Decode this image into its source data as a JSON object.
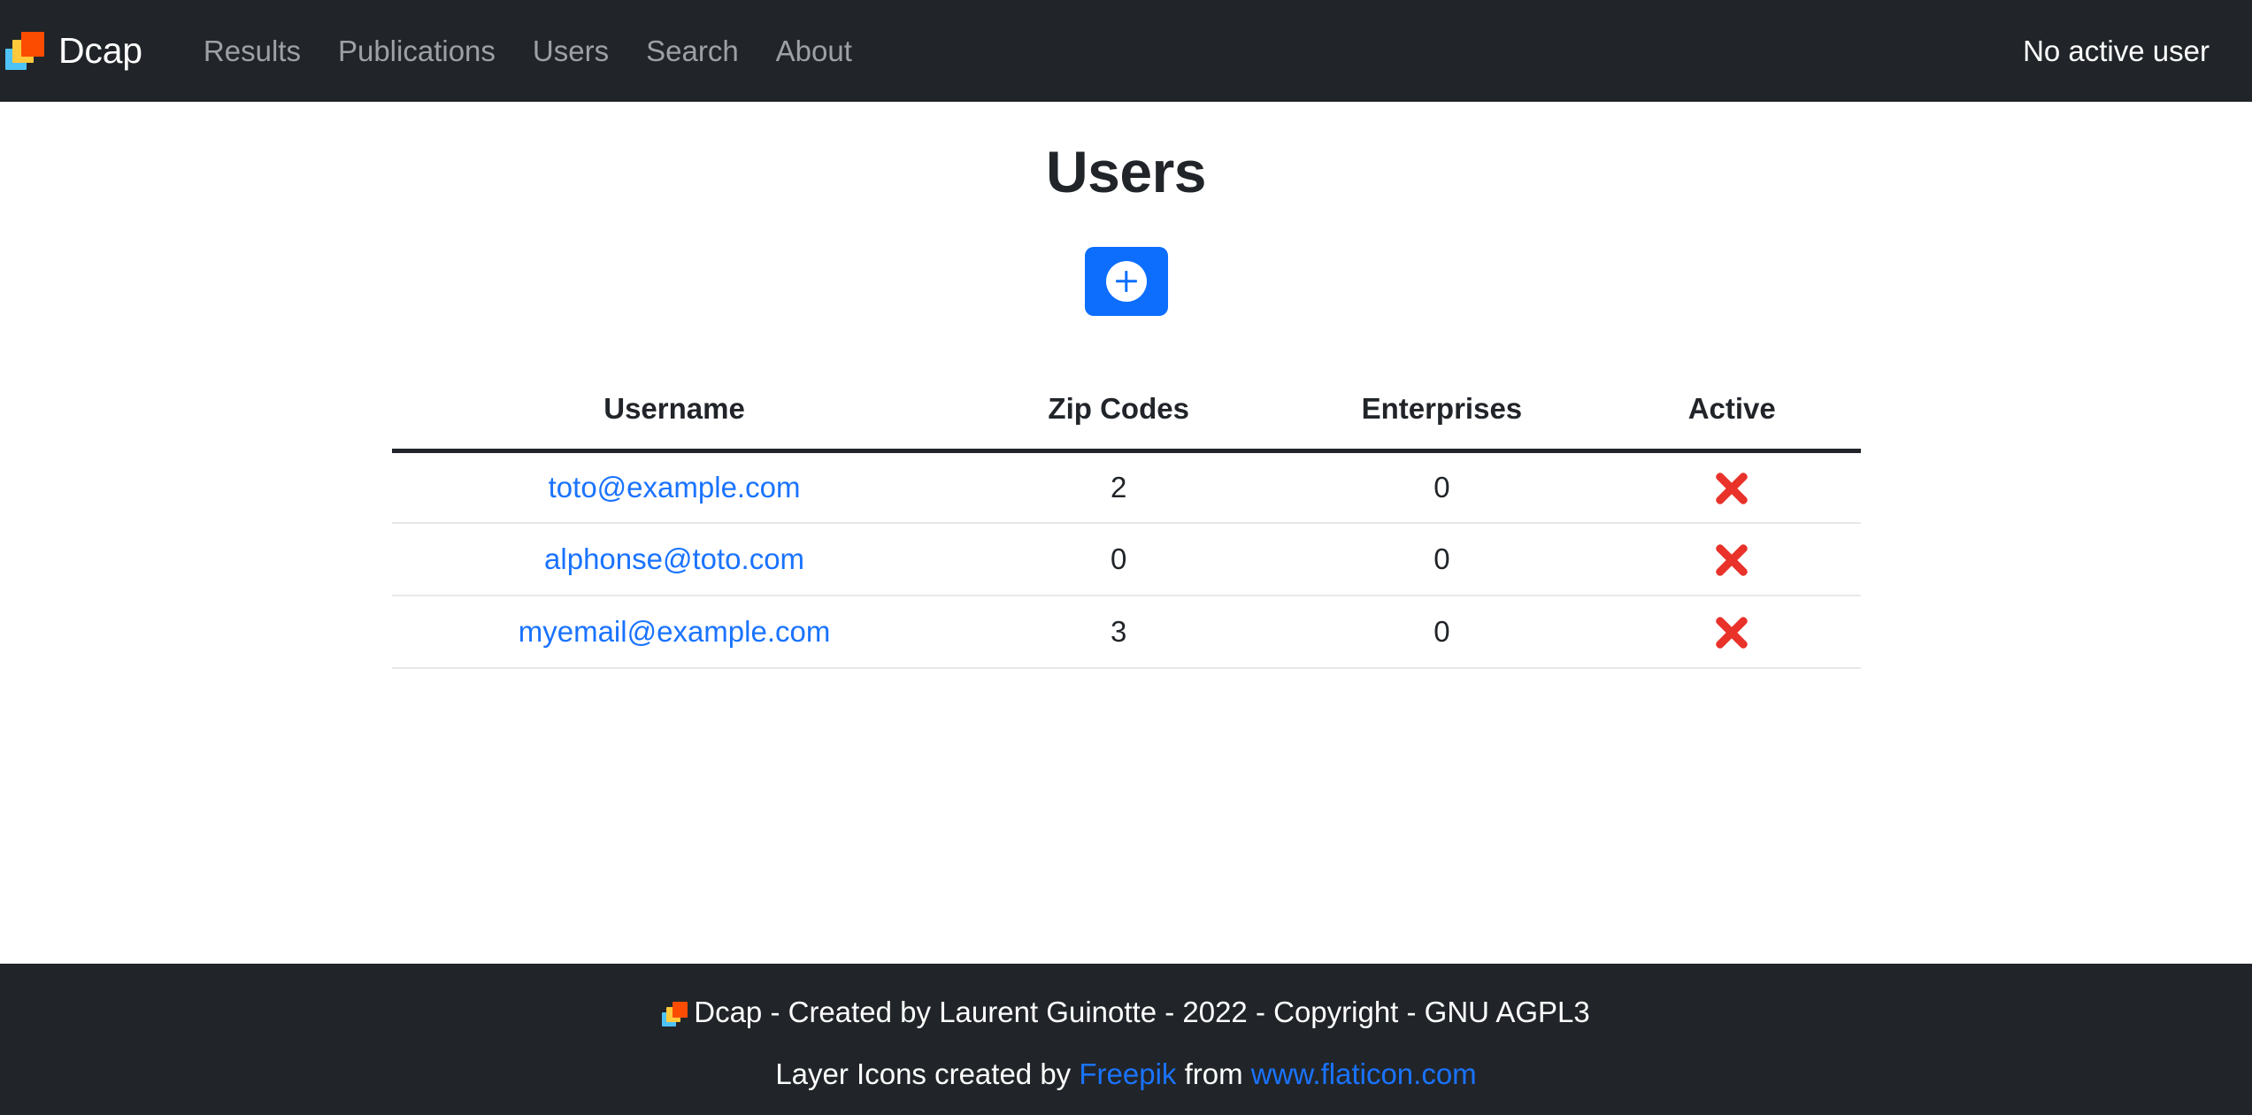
{
  "navbar": {
    "brand_label": "Dcap",
    "brand_icon": "layers-icon",
    "links": [
      {
        "label": "Results"
      },
      {
        "label": "Publications"
      },
      {
        "label": "Users"
      },
      {
        "label": "Search"
      },
      {
        "label": "About"
      }
    ],
    "user_status": "No active user",
    "background_color": "#212529",
    "link_color": "#9da1a6"
  },
  "main": {
    "title": "Users",
    "add_button": {
      "icon": "plus-circle-icon",
      "label": "",
      "color": "#0d6efd"
    },
    "table": {
      "headers": [
        "Username",
        "Zip Codes",
        "Enterprises",
        "Active"
      ],
      "rows": [
        {
          "username": "toto@example.com",
          "zip_codes": "2",
          "enterprises": "0",
          "active": "inactive",
          "active_icon": "red-x-icon"
        },
        {
          "username": "alphonse@toto.com",
          "zip_codes": "0",
          "enterprises": "0",
          "active": "inactive",
          "active_icon": "red-x-icon"
        },
        {
          "username": "myemail@example.com",
          "zip_codes": "3",
          "enterprises": "0",
          "active": "inactive",
          "active_icon": "red-x-icon"
        }
      ],
      "link_color": "#1a73ff",
      "x_color": "#e8322a"
    }
  },
  "footer": {
    "icon": "layers-icon",
    "copyright": "Dcap - Created by Laurent Guinotte - 2022 - Copyright - GNU AGPL3",
    "attribution": {
      "prefix": "Layer Icons created by",
      "link1": "Freepik",
      "middle": "from",
      "link2": "www.flaticon.com"
    },
    "background_color": "#212529"
  }
}
